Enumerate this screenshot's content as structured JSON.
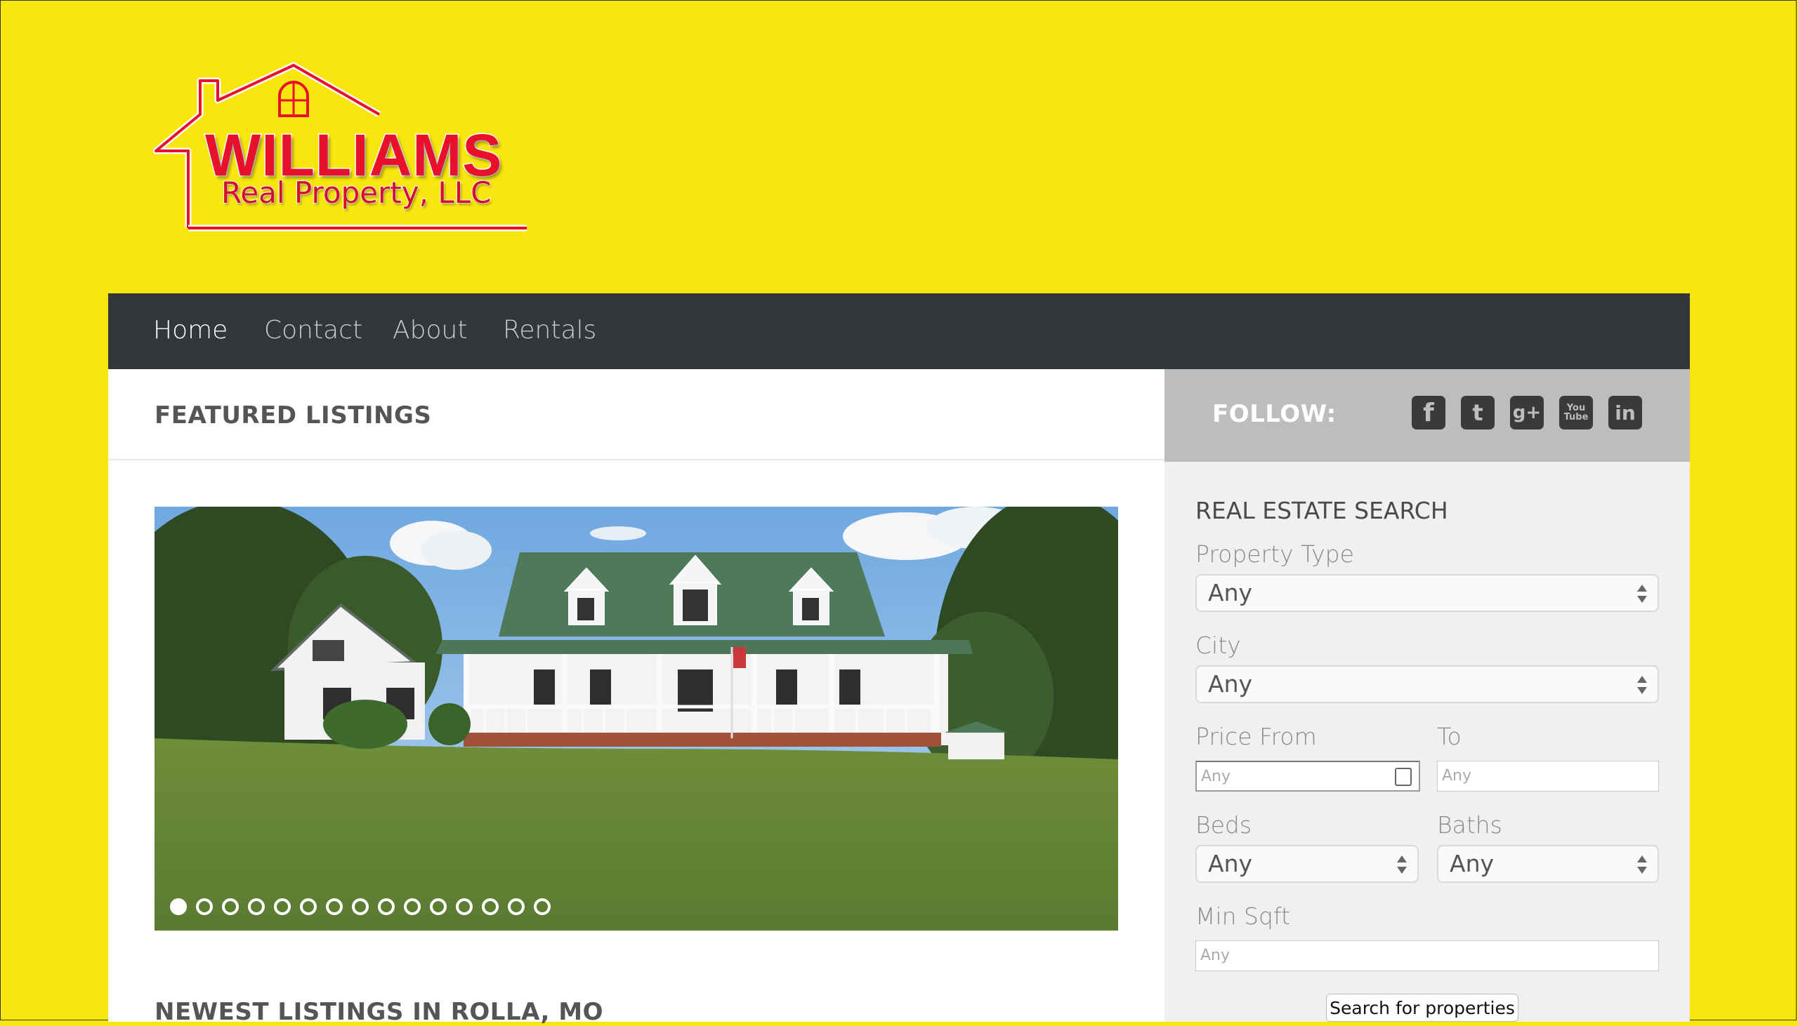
{
  "logo": {
    "name": "WILLIAMS",
    "sub": "Real Property, LLC"
  },
  "nav": [
    {
      "label": "Home",
      "active": true
    },
    {
      "label": "Contact"
    },
    {
      "label": "About"
    },
    {
      "label": "Rentals"
    }
  ],
  "featured": {
    "title": "FEATURED LISTINGS",
    "slide_count": 15,
    "active_slide": 1
  },
  "newest": {
    "title": "NEWEST LISTINGS IN ROLLA, MO"
  },
  "follow": {
    "label": "FOLLOW:",
    "icons": [
      "facebook-icon",
      "twitter-icon",
      "google-plus-icon",
      "youtube-icon",
      "linkedin-icon"
    ],
    "glyphs": [
      "f",
      "t",
      "g+",
      "You Tube",
      "in"
    ]
  },
  "search": {
    "title": "REAL ESTATE SEARCH",
    "property_type_label": "Property Type",
    "property_type_value": "Any",
    "city_label": "City",
    "city_value": "Any",
    "price_from_label": "Price From",
    "price_from_placeholder": "Any",
    "to_label": "To",
    "to_placeholder": "Any",
    "beds_label": "Beds",
    "beds_value": "Any",
    "baths_label": "Baths",
    "baths_value": "Any",
    "min_sqft_label": "Min Sqft",
    "min_sqft_placeholder": "Any",
    "button_label": "Search for properties"
  },
  "colors": {
    "page_bg": "#f9e60e",
    "nav_bg": "#33363b",
    "sidebar_bg": "#f0f0f0",
    "follow_bg": "#bdbdbd",
    "logo_red": "#e8102b"
  }
}
